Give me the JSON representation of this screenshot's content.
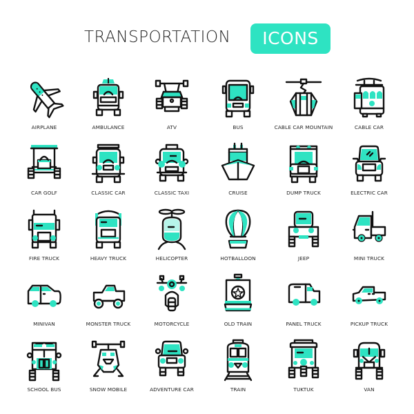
{
  "header": {
    "title": "TRANSPORTATION",
    "badge": "ICONS"
  },
  "colors": {
    "accent": "#2EE3C2",
    "stroke": "#111111",
    "text": "#222222",
    "background": "#FFFFFF"
  },
  "icons": [
    {
      "label": "AIRPLANE",
      "icon": "airplane-icon"
    },
    {
      "label": "AMBULANCE",
      "icon": "ambulance-icon"
    },
    {
      "label": "ATV",
      "icon": "atv-icon"
    },
    {
      "label": "BUS",
      "icon": "bus-icon"
    },
    {
      "label": "CABLE CAR MOUNTAIN",
      "icon": "cable-car-mountain-icon"
    },
    {
      "label": "CABLE CAR",
      "icon": "cable-car-icon"
    },
    {
      "label": "CAR GOLF",
      "icon": "golf-car-icon"
    },
    {
      "label": "CLASSIC CAR",
      "icon": "classic-car-icon"
    },
    {
      "label": "CLASSIC TAXI",
      "icon": "classic-taxi-icon"
    },
    {
      "label": "CRUISE",
      "icon": "cruise-ship-icon"
    },
    {
      "label": "DUMP TRUCK",
      "icon": "dump-truck-icon"
    },
    {
      "label": "ELECTRIC CAR",
      "icon": "electric-car-icon"
    },
    {
      "label": "FIRE TRUCK",
      "icon": "fire-truck-icon"
    },
    {
      "label": "HEAVY TRUCK",
      "icon": "heavy-truck-icon"
    },
    {
      "label": "HELICOPTER",
      "icon": "helicopter-icon"
    },
    {
      "label": "HOTBALLOON",
      "icon": "hot-air-balloon-icon"
    },
    {
      "label": "JEEP",
      "icon": "jeep-icon"
    },
    {
      "label": "MINI TRUCK",
      "icon": "mini-truck-icon"
    },
    {
      "label": "MINIVAN",
      "icon": "minivan-icon"
    },
    {
      "label": "MONSTER TRUCK",
      "icon": "monster-truck-icon"
    },
    {
      "label": "MOTORCYCLE",
      "icon": "motorcycle-icon"
    },
    {
      "label": "OLD TRAIN",
      "icon": "old-train-icon"
    },
    {
      "label": "PANEL TRUCK",
      "icon": "panel-truck-icon"
    },
    {
      "label": "PICKUP TRUCK",
      "icon": "pickup-truck-icon"
    },
    {
      "label": "SCHOOL BUS",
      "icon": "school-bus-icon"
    },
    {
      "label": "SNOW MOBILE",
      "icon": "snow-mobile-icon"
    },
    {
      "label": "ADVENTURE CAR",
      "icon": "adventure-car-icon"
    },
    {
      "label": "TRAIN",
      "icon": "train-icon"
    },
    {
      "label": "TUKTUK",
      "icon": "tuktuk-icon"
    },
    {
      "label": "VAN",
      "icon": "van-icon"
    }
  ]
}
